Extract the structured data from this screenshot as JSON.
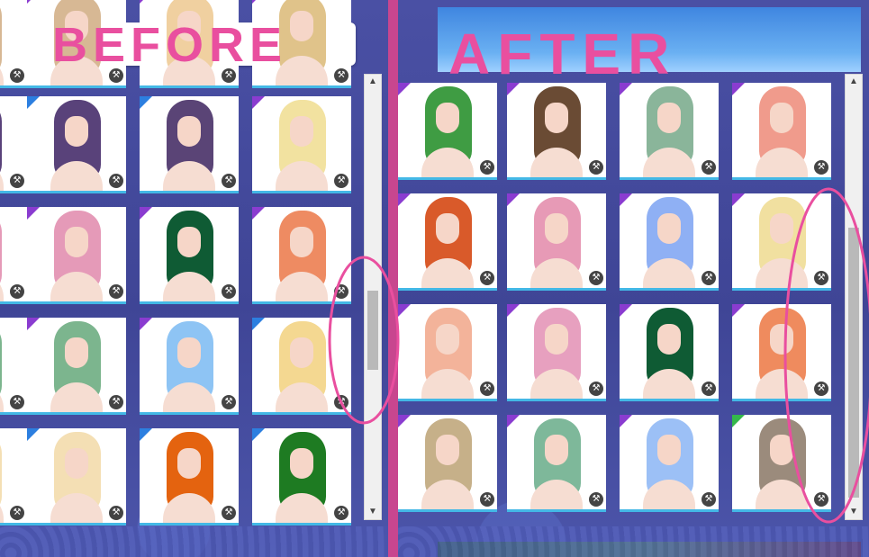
{
  "annotations": {
    "before_label": "BEFORE",
    "after_label": "AFTER",
    "annotation_color": "#e94f9f"
  },
  "left_panel": {
    "dropdown": {
      "value": ""
    },
    "scroll": {
      "position": 0.75
    },
    "hair_colors": [
      [
        "#d7b894",
        "#f0d0a0",
        "#e0c38a"
      ],
      [
        "#59427a",
        "#5a4476",
        "#f2e2a0"
      ],
      [
        "#e59ab8",
        "#0f5b34",
        "#ee8b62"
      ],
      [
        "#7cb58e",
        "#8ec4f4",
        "#f4d891"
      ],
      [
        "#f4dfb4",
        "#e4630f",
        "#1e7b22"
      ]
    ]
  },
  "right_panel": {
    "scroll": {
      "position": 0.72
    },
    "hair_colors": [
      [
        "#3f9c43",
        "#6a4b34",
        "#8ab59a",
        "#f09b8c"
      ],
      [
        "#d95a2a",
        "#e79ab6",
        "#8fb0f4",
        "#f1e0a0"
      ],
      [
        "#f3b39a",
        "#e7a0bf",
        "#0f5b34",
        "#ef8b5e"
      ],
      [
        "#c6b089",
        "#7eb89a",
        "#9cc0f6",
        "#9b8b7c"
      ]
    ],
    "corner_colors": [
      [
        "purple",
        "purple",
        "purple",
        "purple"
      ],
      [
        "purple",
        "purple",
        "purple",
        "purple"
      ],
      [
        "purple",
        "purple",
        "purple",
        "purple"
      ],
      [
        "purple",
        "purple",
        "purple",
        "green"
      ]
    ]
  },
  "icons": {
    "dropdown_chevron": "chevron-down-icon",
    "card_badge": "hanger-icon"
  }
}
